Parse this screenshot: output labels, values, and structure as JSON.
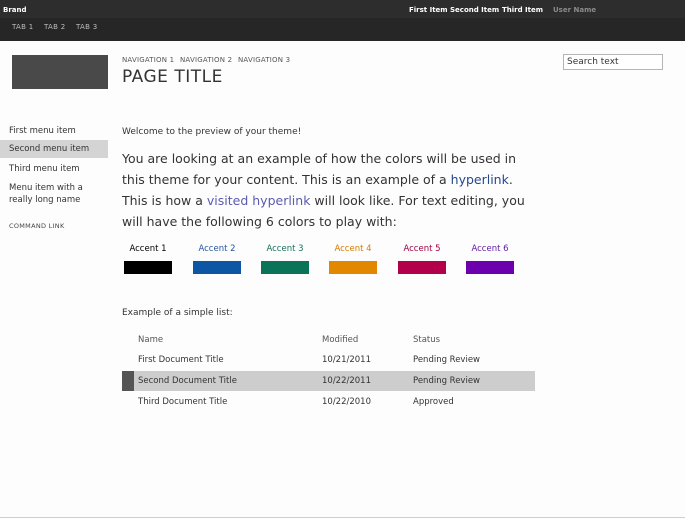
{
  "topbar": {
    "brand": "Brand",
    "nav": [
      "First Item",
      "Second Item",
      "Third Item"
    ],
    "user": "User Name"
  },
  "tabs": [
    "TAB 1",
    "TAB 2",
    "TAB 3"
  ],
  "breadcrumb": [
    "NAVIGATION 1",
    "NAVIGATION 2",
    "NAVIGATION 3"
  ],
  "page_title": "PAGE TITLE",
  "search": {
    "value": "Search text"
  },
  "sidebar": {
    "items": [
      {
        "label": "First menu item",
        "selected": false
      },
      {
        "label": "Second menu item",
        "selected": true
      },
      {
        "label": "Third menu item",
        "selected": false
      },
      {
        "label": "Menu item with a really long name",
        "selected": false
      }
    ],
    "command_link": "COMMAND LINK"
  },
  "content": {
    "welcome": "Welcome to the preview of your theme!",
    "para_1": "You are looking at an example of how the colors will be used in this theme for your content. This is an example of a ",
    "hyperlink": "hyperlink",
    "para_2": ". This is how a ",
    "visited_hyperlink": "visited hyperlink",
    "para_3": " will look like. For text editing, you will have the following 6 colors to play with:"
  },
  "accents": [
    {
      "label": "Accent 1",
      "color": "#000000",
      "text_color": "#000000"
    },
    {
      "label": "Accent 2",
      "color": "#0c56a3",
      "text_color": "#24569c"
    },
    {
      "label": "Accent 3",
      "color": "#0b7358",
      "text_color": "#167058"
    },
    {
      "label": "Accent 4",
      "color": "#e28800",
      "text_color": "#d37d00"
    },
    {
      "label": "Accent 5",
      "color": "#b2004b",
      "text_color": "#a0003f"
    },
    {
      "label": "Accent 6",
      "color": "#6c00ae",
      "text_color": "#5e1aa0"
    }
  ],
  "list": {
    "caption": "Example of a simple list:",
    "headers": [
      "Name",
      "Modified",
      "Status"
    ],
    "rows": [
      {
        "name": "First Document Title",
        "modified": "10/21/2011",
        "status": "Pending Review",
        "selected": false
      },
      {
        "name": "Second Document Title",
        "modified": "10/22/2011",
        "status": "Pending Review",
        "selected": true
      },
      {
        "name": "Third Document Title",
        "modified": "10/22/2010",
        "status": "Approved",
        "selected": false
      }
    ]
  }
}
